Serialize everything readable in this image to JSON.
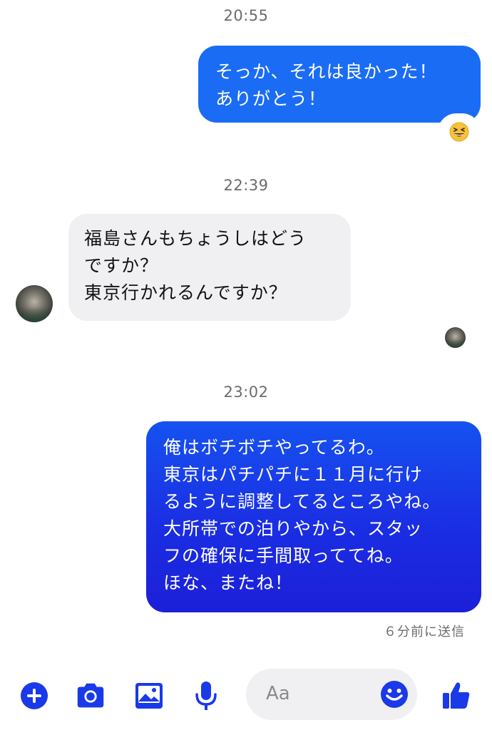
{
  "thread": {
    "timestamps": [
      "20:55",
      "22:39",
      "23:02"
    ],
    "messages": [
      {
        "direction": "outgoing",
        "text": "そっか、それは良かった！\nありがとう！",
        "reaction": "grinning-squinting-face"
      },
      {
        "direction": "incoming",
        "text": "福島さんもちょうしはどう\nですか？\n東京行かれるんですか？"
      },
      {
        "direction": "outgoing",
        "text": "俺はボチボチやってるわ。\n東京はパチパチに１１月に行け\nるように調整してるところやね。\n大所帯での泊りやから、スタッ\nフの確保に手間取っててね。\nほな、またね！"
      }
    ],
    "sent_status": "６分前に送信"
  },
  "composer": {
    "placeholder": "Aa",
    "icons": [
      "plus-icon",
      "camera-icon",
      "image-icon",
      "microphone-icon",
      "emoji-icon",
      "thumbs-up-icon"
    ]
  },
  "colors": {
    "accent": "#1a6cf5",
    "accent_dark": "#1c1fd8",
    "incoming_bubble": "#f0f0f2",
    "meta_text": "#6b6b70"
  }
}
